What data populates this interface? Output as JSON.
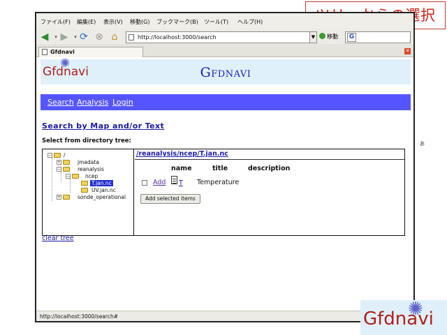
{
  "slide": {
    "title": "ツリーからの選択",
    "side_char": "あ",
    "corner_logo_text": "Gfdnavi"
  },
  "browser": {
    "menu": [
      "ファイル(F)",
      "編集(E)",
      "表示(V)",
      "移動(G)",
      "ブックマーク(B)",
      "ツール(T)",
      "ヘルプ(H)"
    ],
    "url": "http://localhost:3000/search",
    "go_label": "移動",
    "search_placeholder": "",
    "tab_label": "Gfdnavi",
    "status_text": "http://localhost:3000/search#"
  },
  "page": {
    "logo_text": "Gfdnavi",
    "header_title": "Gfdnavi",
    "nav": [
      "Search",
      "Analysis",
      "Login"
    ],
    "section_link": "Search by Map and/or Text",
    "select_label": "Select from directory tree:",
    "tree": {
      "root": "/",
      "items": [
        "jmadata",
        "reanalysis",
        "ncep",
        "T.jan.nc",
        "UV.jan.nc",
        "sonde_operational"
      ]
    },
    "path": "/reanalysis/ncep/T.jan.nc",
    "columns": [
      "name",
      "title",
      "description"
    ],
    "row": {
      "add_label": "Add",
      "name": "T",
      "title": "Temperature",
      "description": ""
    },
    "add_button": "Add selected items",
    "clear_tree": "clear tree"
  },
  "colors": {
    "nav_band": "#5555ff",
    "header_bg": "#dff0fb",
    "link": "#1a1aa8",
    "title_red": "#d0241b",
    "selection": "#1f2fd1"
  }
}
